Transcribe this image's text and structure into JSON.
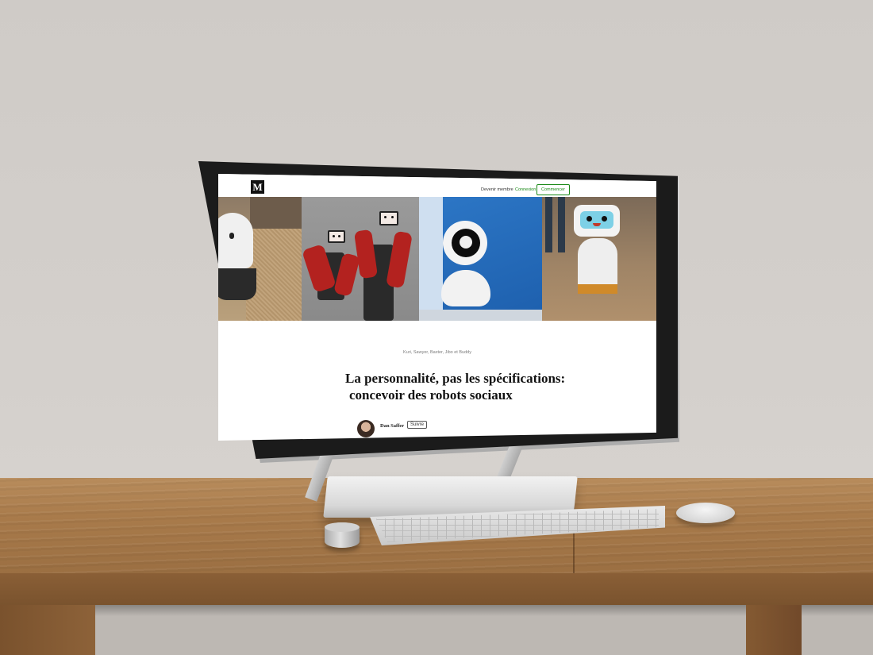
{
  "site": {
    "logo_letter": "M",
    "nav": {
      "become_member": "Devenir membre",
      "login": "Connexion",
      "start": "Commencer"
    }
  },
  "article": {
    "image_caption": "Kuri, Sawyer, Baxter, Jibo et Buddy",
    "title_line1": "La personnalité, pas les spécifications:",
    "title_line2": "concevoir des robots sociaux",
    "author_name": "Dan Saffer",
    "follow_label": "Suivre"
  },
  "colors": {
    "accent_green": "#1a8917",
    "desk_wood": "#a97b4b",
    "wall": "#d3cfcb"
  }
}
